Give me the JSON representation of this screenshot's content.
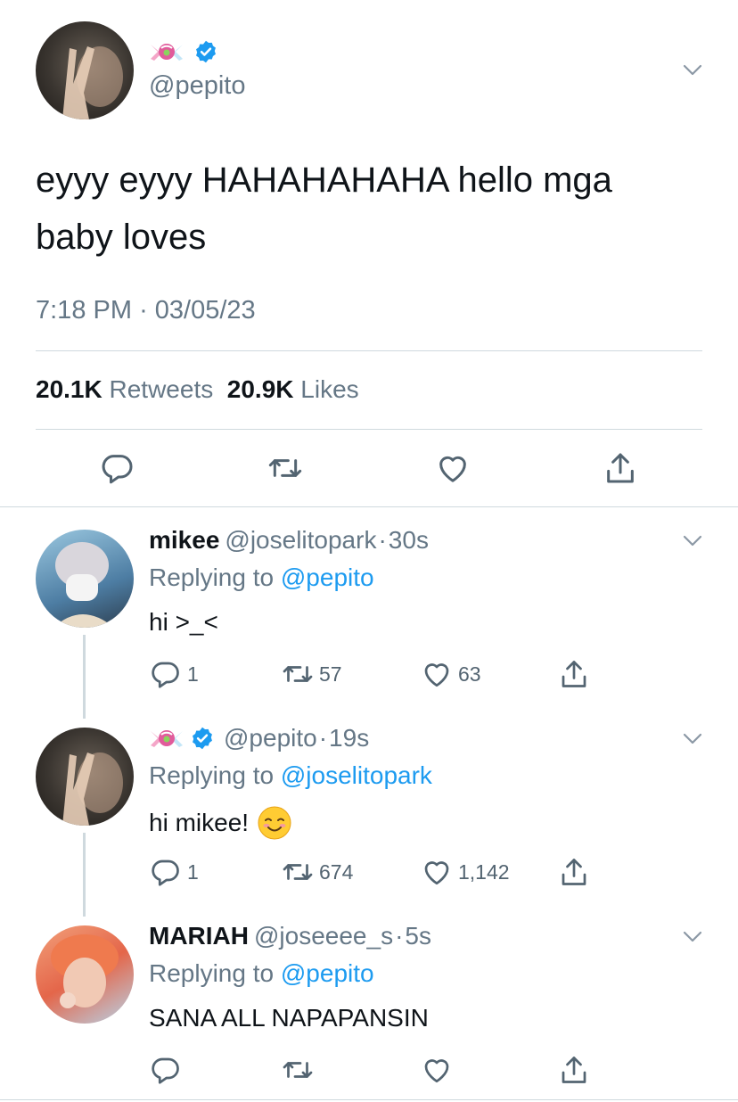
{
  "main_tweet": {
    "handle": "@pepito",
    "display_name_emoji": "candy",
    "text": "eyyy eyyy HAHAHAHAHA hello mga baby loves",
    "time": "7:18 PM",
    "date": "03/05/23",
    "retweets_count": "20.1K",
    "retweets_label": "Retweets",
    "likes_count": "20.9K",
    "likes_label": "Likes"
  },
  "replies": [
    {
      "name": "mikee",
      "handle": "@joselitopark",
      "time": "30s",
      "replying_label": "Replying to",
      "replying_to": "@pepito",
      "text": "hi >_<",
      "comments": "1",
      "retweets": "57",
      "likes": "63"
    },
    {
      "name": "",
      "handle": "@pepito",
      "time": "19s",
      "replying_label": "Replying to",
      "replying_to": "@joselitopark",
      "text": "hi mikee!",
      "comments": "1",
      "retweets": "674",
      "likes": "1,142"
    },
    {
      "name": "MARIAH",
      "handle": "@joseeee_s",
      "time": "5s",
      "replying_label": "Replying to",
      "replying_to": "@pepito",
      "text": "SANA ALL NAPAPANSIN"
    }
  ],
  "separator": "·",
  "colors": {
    "accent": "#1d9bf0",
    "muted": "#657786",
    "text": "#0f1419",
    "divider": "#cfd9de"
  }
}
